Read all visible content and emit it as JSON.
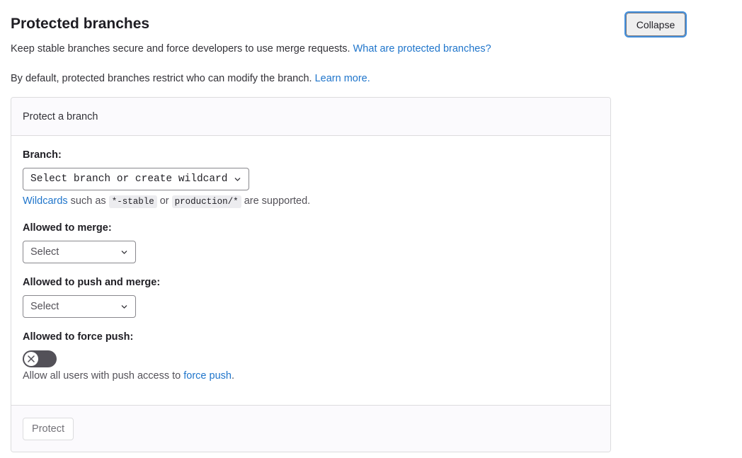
{
  "header": {
    "title": "Protected branches",
    "collapse_label": "Collapse"
  },
  "intro": {
    "text1": "Keep stable branches secure and force developers to use merge requests. ",
    "link1": "What are protected branches?",
    "text2": "By default, protected branches restrict who can modify the branch. ",
    "link2": "Learn more."
  },
  "card": {
    "header_title": "Protect a branch",
    "branch_label": "Branch:",
    "branch_placeholder": "Select branch or create wildcard",
    "wildcard_link": "Wildcards",
    "wildcard_text1": " such as ",
    "wildcard_example1": "*-stable",
    "wildcard_text2": " or ",
    "wildcard_example2": "production/*",
    "wildcard_text3": " are supported.",
    "merge_label": "Allowed to merge:",
    "merge_select": "Select",
    "push_label": "Allowed to push and merge:",
    "push_select": "Select",
    "force_label": "Allowed to force push:",
    "force_enabled": false,
    "force_help_text": "Allow all users with push access to ",
    "force_help_link": "force push",
    "force_help_end": ".",
    "protect_label": "Protect"
  },
  "icons": {
    "chevron": "chevron-down-icon",
    "toggle_off": "close-icon"
  },
  "colors": {
    "link": "#1f75cb",
    "toggle_off": "#535158",
    "focus_ring": "#428fdc"
  }
}
